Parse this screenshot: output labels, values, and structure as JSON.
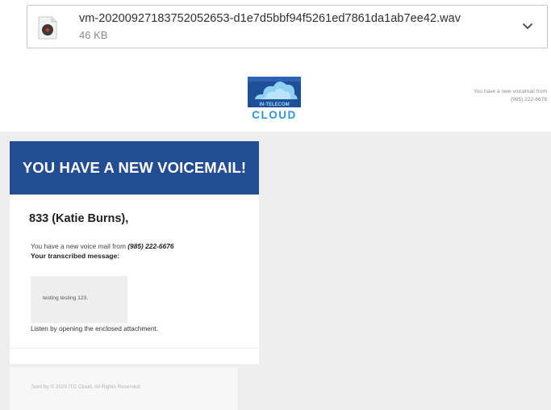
{
  "attachment": {
    "file_name": "vm-20200927183752052653-d1e7d5bbf94f5261ed7861da1ab7ee42.wav",
    "file_size": "46 KB",
    "file_icon": "audio-file-icon",
    "expand_icon": "chevron-down-icon"
  },
  "header": {
    "logo_top_text": "IN-TELECOM",
    "logo_word": "CLOUD",
    "logo_icon": "cloud-logo-icon",
    "notice_line1": "You have a new voicemail from",
    "notice_line2": "(985) 222-6676"
  },
  "email": {
    "banner": "YOU HAVE A NEW VOICEMAIL!",
    "greeting": "833 (Katie Burns),",
    "from_prefix": "You have a new voice mail from ",
    "from_number": "(985) 222-6676",
    "transcribed_label": "Your transcribed message:",
    "transcript": "testing testing 123.",
    "listen_instruction": "Listen by opening the enclosed attachment."
  },
  "footer": {
    "text": "Sent by © 2020 ITC Cloud, All Rights Reserved."
  },
  "colors": {
    "banner_blue": "#234d93",
    "logo_blue": "#2f95d8",
    "panel_gray": "#eeeeee"
  }
}
